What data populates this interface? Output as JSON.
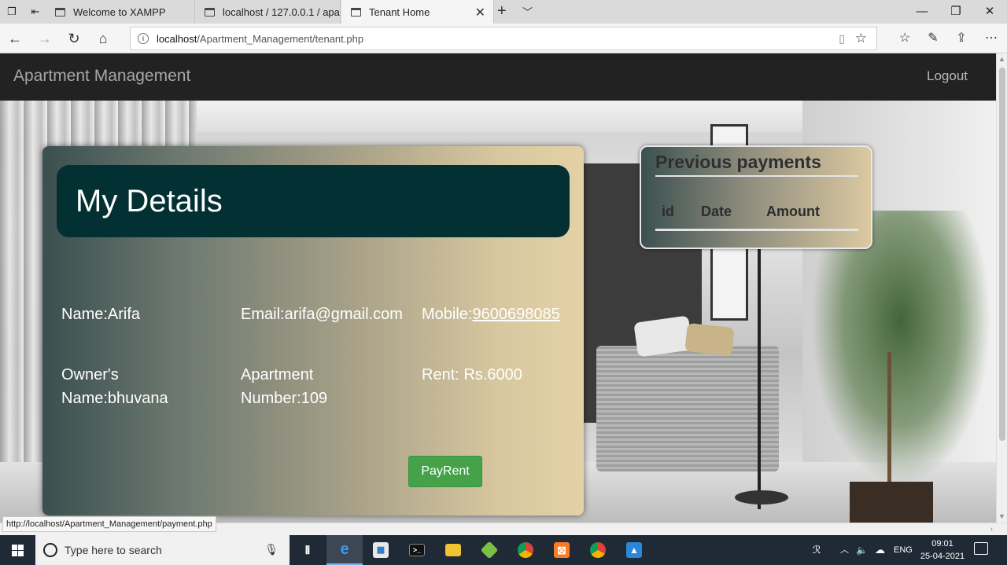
{
  "browser": {
    "tabs": [
      {
        "label": "Welcome to XAMPP",
        "active": false
      },
      {
        "label": "localhost / 127.0.0.1 / apartr",
        "active": false
      },
      {
        "label": "Tenant Home",
        "active": true
      }
    ],
    "address": {
      "host": "localhost",
      "path": "/Apartment_Management/tenant.php"
    },
    "status_url": "http://localhost/Apartment_Management/payment.php"
  },
  "header": {
    "brand": "Apartment Management",
    "logout": "Logout"
  },
  "details": {
    "title": "My Details",
    "name": "Name:Arifa",
    "email": "Email:arifa@gmail.com",
    "mobile_label": "Mobile:",
    "mobile_value": "9600698085",
    "owner_line1": "Owner's",
    "owner_line2": "Name:bhuvana",
    "apartment_line1": "Apartment",
    "apartment_line2": "Number:109",
    "rent": "Rent: Rs.6000",
    "pay_button": "PayRent"
  },
  "previous_payments": {
    "title": "Previous payments",
    "columns": [
      "id",
      "Date",
      "Amount"
    ]
  },
  "taskbar": {
    "search_placeholder": "Type here to search",
    "language": "ENG",
    "time": "09:01",
    "date": "25-04-2021"
  },
  "colors": {
    "header_bg": "#222222",
    "details_head_bg": "#023033",
    "pay_button_bg": "#45a249"
  }
}
